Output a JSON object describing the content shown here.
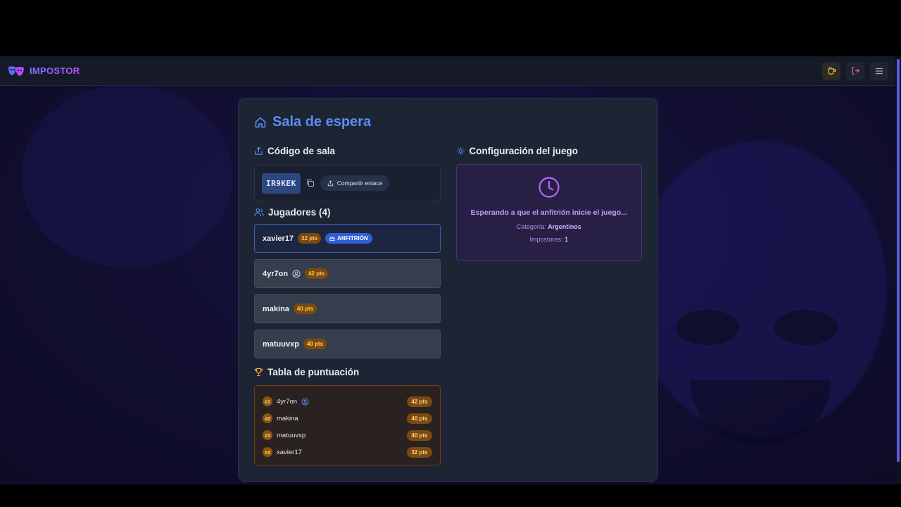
{
  "app": {
    "name": "IMPOSTOR"
  },
  "colors": {
    "accent": "#5b8cf5",
    "purple": "#c59cff",
    "points": "#7b4a0e",
    "host_badge": "#2f5fd6"
  },
  "header": {
    "icons": [
      "masks-logo-icon",
      "coffee-icon",
      "logout-icon",
      "menu-icon"
    ]
  },
  "lobby": {
    "title": "Sala de espera",
    "room_code_title": "Código de sala",
    "room_code": "IR9KEK",
    "share_label": "Compartir enlace",
    "players_title": "Jugadores (4)",
    "players": [
      {
        "name": "xavier17",
        "points": "32 pts",
        "badge": "ANFITRIÓN"
      },
      {
        "name": "4yr7on",
        "points": "42 pts"
      },
      {
        "name": "makina",
        "points": "40 pts"
      },
      {
        "name": "matuuvxp",
        "points": "40 pts"
      }
    ],
    "scoreboard_title": "Tabla de puntuación",
    "scoreboard": [
      {
        "rank": "#1",
        "name": "4yr7on",
        "points": "42 pts"
      },
      {
        "rank": "#2",
        "name": "makina",
        "points": "40 pts"
      },
      {
        "rank": "#3",
        "name": "matuuvxp",
        "points": "40 pts"
      },
      {
        "rank": "#4",
        "name": "xavier17",
        "points": "32 pts"
      }
    ]
  },
  "config": {
    "title": "Configuración del juego",
    "waiting_message": "Esperando a que el anfitrión inicie el juego...",
    "category_label": "Categoría:",
    "category_value": "Argentinos",
    "impostors_label": "Impostores:",
    "impostors_value": "1"
  }
}
